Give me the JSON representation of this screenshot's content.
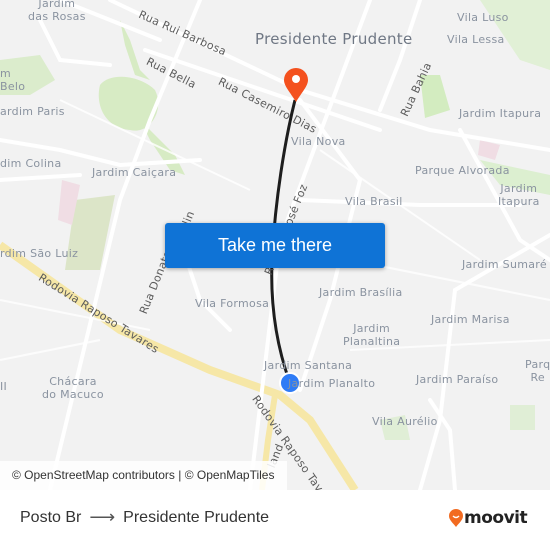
{
  "map": {
    "city_label": "Presidente Prudente",
    "neighborhoods": [
      {
        "name": "Jardim das Rosas",
        "text": "Jardim\ndas Rosas"
      },
      {
        "name": "Jardim Belo",
        "text": "m\nBelo"
      },
      {
        "name": "Jardim Paris",
        "text": "ardim Paris"
      },
      {
        "name": "Jardim Colina",
        "text": "dim Colina"
      },
      {
        "name": "Jardim Caiçara",
        "text": "Jardim Caiçara"
      },
      {
        "name": "Vila Luso",
        "text": "Vila Luso"
      },
      {
        "name": "Vila Lessa",
        "text": "Vila Lessa"
      },
      {
        "name": "Jardim Itapura",
        "text": "Jardim Itapura"
      },
      {
        "name": "Vila Nova",
        "text": "Vila Nova"
      },
      {
        "name": "Parque Alvorada",
        "text": "Parque Alvorada"
      },
      {
        "name": "Jardim Itapura 2",
        "text": "Jardim\nItapura"
      },
      {
        "name": "Vila Brasil",
        "text": "Vila Brasil"
      },
      {
        "name": "Jardim São Luiz",
        "text": "rdim São Luiz"
      },
      {
        "name": "Jardim Sumaré",
        "text": "Jardim Sumaré"
      },
      {
        "name": "Jardim Brasília",
        "text": "Jardim Brasília"
      },
      {
        "name": "Vila Formosa",
        "text": "Vila Formosa"
      },
      {
        "name": "Jardim Planaltina",
        "text": "Jardim\nPlanaltina"
      },
      {
        "name": "Jardim Marisa",
        "text": "Jardim Marisa"
      },
      {
        "name": "Jardim Santana",
        "text": "Jardim Santana"
      },
      {
        "name": "Jardim Planalto",
        "text": "Jardim Planalto"
      },
      {
        "name": "Jardim Paraíso",
        "text": "Jardim Paraíso"
      },
      {
        "name": "Parque Residencial",
        "text": "Parq\nRe"
      },
      {
        "name": "Chácara do Macuco",
        "text": "Chácara\ndo Macuco"
      },
      {
        "name": "II",
        "text": "II"
      },
      {
        "name": "Vila Aurélio",
        "text": "Vila Aurélio"
      }
    ],
    "streets": [
      {
        "name": "Rua Rui Barbosa"
      },
      {
        "name": "Rua Bella"
      },
      {
        "name": "Rua Casemiro Dias"
      },
      {
        "name": "Rua Bahia"
      },
      {
        "name": "Rua Doutor José Foz",
        "text": "Rua Dor José Foz"
      },
      {
        "name": "Rua Donato",
        "text": "Rua Donato"
      },
      {
        "name": "Rodovia Raposo Tavares"
      },
      {
        "name": "Rodovia Raposo Tavares 2",
        "text": "Rodovia Raposo Tavares"
      },
      {
        "name": "Rua Donato Armelin fragment",
        "text": "lin"
      },
      {
        "name": "Rua ...land fragment",
        "text": "land"
      }
    ],
    "origin_color": "#2f7cf6",
    "destination_color": "#f4511e",
    "route_color": "#1e1e1e"
  },
  "cta": {
    "label": "Take me there",
    "color": "#0f73d6"
  },
  "attribution": "© OpenStreetMap contributors | © OpenMapTiles",
  "footer": {
    "origin": "Posto Br",
    "arrow": "⟶",
    "destination": "Presidente Prudente",
    "brand": "moovit",
    "brand_color": "#f26b21"
  }
}
